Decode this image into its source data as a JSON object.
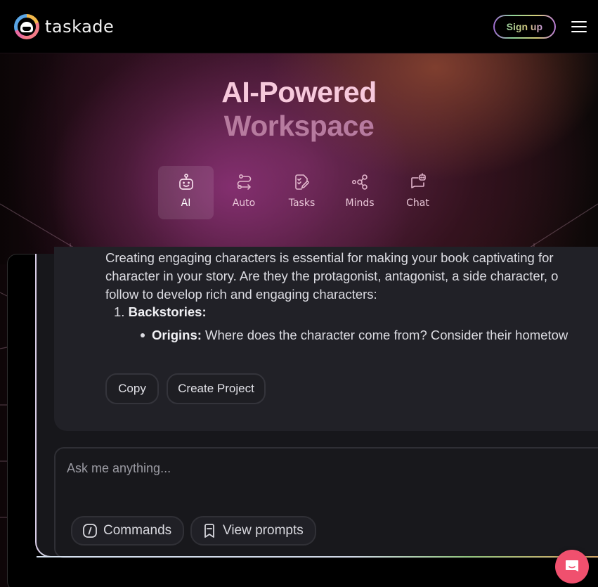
{
  "header": {
    "brand": "taskade",
    "signup_label": "Sign up",
    "menu_icon": "hamburger-menu-icon"
  },
  "hero": {
    "title_line1": "AI-Powered",
    "title_line2": "Workspace"
  },
  "tabs": [
    {
      "label": "AI",
      "icon": "robot-icon",
      "active": true
    },
    {
      "label": "Auto",
      "icon": "workflow-icon",
      "active": false
    },
    {
      "label": "Tasks",
      "icon": "task-edit-icon",
      "active": false
    },
    {
      "label": "Minds",
      "icon": "share-nodes-icon",
      "active": false
    },
    {
      "label": "Chat",
      "icon": "chat-bot-icon",
      "active": false
    }
  ],
  "chat": {
    "message_lines": [
      "Creating engaging characters is essential for making your book captivating for",
      "character in your story. Are they the protagonist, antagonist, a side character, o",
      "follow to develop rich and engaging characters:"
    ],
    "list_item_number": "1.",
    "list_item_title": "Backstories:",
    "bullet_title": "Origins:",
    "bullet_text": " Where does the character come from? Consider their hometow",
    "actions": {
      "copy_label": "Copy",
      "create_project_label": "Create Project"
    }
  },
  "composer": {
    "placeholder": "Ask me anything...",
    "value": "",
    "commands_label": "Commands",
    "view_prompts_label": "View prompts"
  },
  "colors": {
    "accent_pink": "#f7c9dc",
    "support_button": "#f0506e",
    "panel_bg": "#17171b"
  }
}
